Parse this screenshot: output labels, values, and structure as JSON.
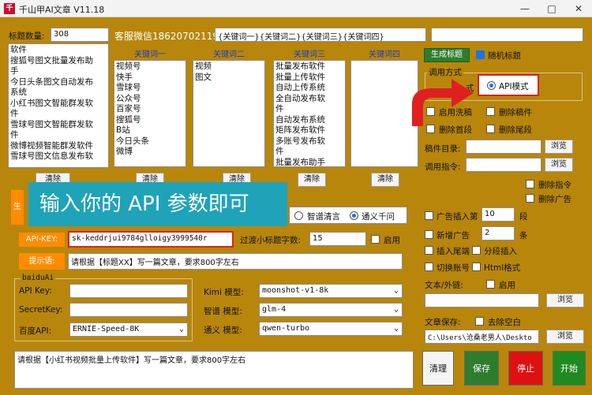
{
  "window": {
    "title": "千山甲AI文章 V11.18",
    "app_icon_text": "千"
  },
  "top": {
    "title_count_label": "标题数量:",
    "title_count_value": "308",
    "wechat_text": "客服微信18620702119",
    "keyword_template": "{关键词一}{关键词二}{关键词三}{关键词四}",
    "generate_title_btn": "生成标题",
    "random_title_label": "随机标题"
  },
  "titles_list": [
    "软件",
    "搜狐号图文批量发布助",
    "手",
    "今日头条图文自动发布",
    "系统",
    "小红书图文智能群发软",
    "件",
    "雪球号图文智能群发软",
    "件",
    "微博视频智能群发软件",
    "雪球号图文信息发布软"
  ],
  "keywords": {
    "col1": {
      "header": "关键词一",
      "items": [
        "视频号",
        "快手",
        "雪球号",
        "公众号",
        "百家号",
        "搜狐号",
        "B站",
        "今日头条",
        "微博"
      ]
    },
    "col2": {
      "header": "关键词二",
      "items": [
        "视频",
        "图文"
      ]
    },
    "col3": {
      "header": "关键词三",
      "items": [
        "批量发布软件",
        "批量上传软件",
        "自动上传系统",
        "全自动发布软",
        "件",
        "自动发布系统",
        "矩阵发布软件",
        "多账号发布软",
        "件",
        "批量发布助手"
      ]
    },
    "col4": {
      "header": "关键词四",
      "items": []
    }
  },
  "clear_label": "清除",
  "overlay_banner": "输入你的 API 参数即可",
  "hidden_generate_prefix": "生",
  "model_radio": {
    "zhipu": "智谱清言",
    "tongyi": "通义千问"
  },
  "api_key": {
    "label": "API-KEY:",
    "value": "sk-keddrjui9784glloigy3999540r"
  },
  "subtitle_words": {
    "label": "过渡小标题字数:",
    "value": "15",
    "enable": "启用"
  },
  "prompt": {
    "label": "提示语:",
    "value": "请根据【标题XX】写一篇文章，要求800字左右"
  },
  "baidu": {
    "group_title": "baiduAi",
    "api_key_label": "API Key:",
    "secret_label": "SecretKey:",
    "baidu_api_label": "百度API:",
    "baidu_api_value": "ERNIE-Speed-8K"
  },
  "models": {
    "kimi_label": "Kimi 模型:",
    "kimi_value": "moonshot-v1-8k",
    "zhipu_label": "智谱 模型:",
    "zhipu_value": "glm-4",
    "tongyi_label": "通义 模型:",
    "tongyi_value": "qwen-turbo"
  },
  "bottom_text": "请根据【小红书视频批量上传软件】写一篇文章，要求800字左右",
  "right": {
    "call_method_label": "调用方式",
    "mode_left_partial": "式",
    "api_mode_label": "API模式",
    "wash": "启用洗稿",
    "delete_draft": "删除稿件",
    "delete_first": "删除首段",
    "delete_last": "删除尾段",
    "draft_dir_label": "稿件目录:",
    "call_cmd_label": "调用指令:",
    "browse": "浏览",
    "delete_cmd": "删除指令",
    "delete_ad": "删除广告",
    "ad_insert_label": "广告插入第",
    "ad_insert_value": "10",
    "ad_insert_unit": "段",
    "new_ad_label": "新增广告",
    "new_ad_value": "2",
    "new_ad_unit": "条",
    "insert_tail": "插入尾端",
    "seg_insert": "分段插入",
    "switch_account": "切换账号",
    "html_format": "Html格式",
    "text_chain_label": "文本/外链:",
    "text_chain_enable": "启用",
    "article_save_label": "文章保存:",
    "remove_space": "去除空白",
    "save_path": "C:\\Users\\沧桑老男人\\Deskto"
  },
  "actions": {
    "clear": "清理",
    "save": "保存",
    "stop": "停止",
    "start": "开始"
  },
  "colors": {
    "bg": "#b8860b",
    "accent_orange": "#ff8c00",
    "overlay_teal": "#1fa3b8",
    "red_border": "#e02020",
    "save_green": "#2e7d2e",
    "stop_red": "#d11",
    "start_green": "#1f8a1f"
  }
}
